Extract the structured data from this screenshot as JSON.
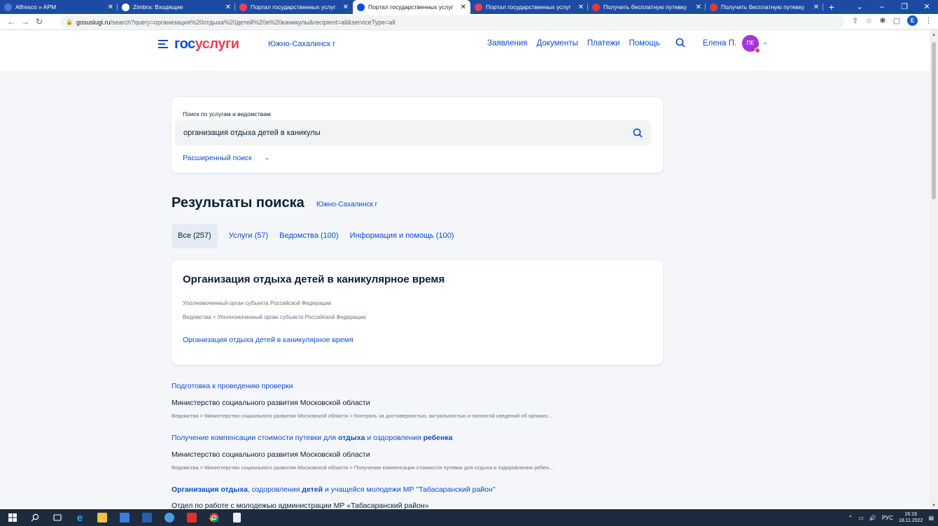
{
  "browser": {
    "tabs": [
      {
        "title": "Alfresco » APM",
        "color": "#4a7bd0"
      },
      {
        "title": "Zimbra: Входящие",
        "color": "#ffffff"
      },
      {
        "title": "Портал государственных услуг",
        "color": "#ee3f58"
      },
      {
        "title": "Портал государственных услуг",
        "color": "#0d4cd3"
      },
      {
        "title": "Портал государственных услуг",
        "color": "#ee3f58"
      },
      {
        "title": "Получить бесплатную путевку",
        "color": "#e53935"
      },
      {
        "title": "Получить бесплатную путевку",
        "color": "#e53935"
      }
    ],
    "new_tab": "+",
    "url_host": "gosuslugi.ru",
    "url_path": "/search?query=организация%20отдыха%20детей%20в%20каникулы&recipient=all&serviceType=all",
    "profile_initial": "E"
  },
  "header": {
    "logo_part1": "гос",
    "logo_part2": "услуги",
    "region": "Южно-Сахалинск г",
    "nav": [
      "Заявления",
      "Документы",
      "Платежи",
      "Помощь"
    ],
    "user_name": "Елена П.",
    "avatar_initials": "ПЕ"
  },
  "search": {
    "label": "Поиск по услугам и ведомствам",
    "value": "организация отдыха детей в каникулы",
    "advanced": "Расширенный поиск"
  },
  "results": {
    "title": "Результаты поиска",
    "region": "Южно-Сахалинск г",
    "filters": [
      {
        "label": "Все (257)",
        "active": true
      },
      {
        "label": "Услуги (57)",
        "active": false
      },
      {
        "label": "Ведомства (100)",
        "active": false
      },
      {
        "label": "Информация и помощь (100)",
        "active": false
      }
    ],
    "featured": {
      "title": "Организация отдыха детей в каникулярное время",
      "line1": "Уполномоченный орган субъекта Российской Федерации",
      "line2": "Ведомства > Уполномоченный орган субъекта Российской Федерации",
      "link": "Организация отдыха детей в каникулярное время"
    },
    "items": [
      {
        "title_parts": [
          {
            "t": "Подготовка к проведению проверки",
            "b": false
          }
        ],
        "org": "Министерство социального развития Московской области",
        "path": "Ведомства > Министерство социального развития Московской области > Контроль за достоверностью, актуальностью и полнотой сведений об организ..."
      },
      {
        "title_parts": [
          {
            "t": "Получение компенсации стоимости путевки для ",
            "b": false
          },
          {
            "t": "отдыха",
            "b": true
          },
          {
            "t": " и оздоровления ",
            "b": false
          },
          {
            "t": "ребенка",
            "b": true
          }
        ],
        "org": "Министерство социального развития Московской области",
        "path": "Ведомства > Министерство социального развития Московской области > Получение компенсации стоимости путевки для отдыха и оздоровления ребен..."
      },
      {
        "title_parts": [
          {
            "t": "Организация отдыха",
            "b": true
          },
          {
            "t": ", оздоровления ",
            "b": false
          },
          {
            "t": "детей",
            "b": true
          },
          {
            "t": " и учащейся молодежи МР \"Табасаранский район\"",
            "b": false
          }
        ],
        "org": "Отдел по работе с молодежью администрации МР «Табасаранский район»",
        "path": ""
      }
    ]
  },
  "taskbar": {
    "lang": "РУС",
    "time": "16:19",
    "date": "18.11.2022"
  }
}
